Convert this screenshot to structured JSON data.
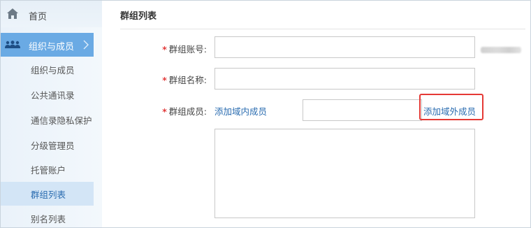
{
  "sidebar": {
    "home_label": "首页",
    "group_label": "组织与成员",
    "items": [
      {
        "label": "组织与成员"
      },
      {
        "label": "公共通讯录"
      },
      {
        "label": "通信录隐私保护"
      },
      {
        "label": "分级管理员"
      },
      {
        "label": "托管账户"
      },
      {
        "label": "群组列表"
      },
      {
        "label": "别名列表"
      }
    ],
    "active_item": "群组列表"
  },
  "main": {
    "title": "群组列表",
    "form": {
      "required_mark": "*",
      "account_label": "群组账号:",
      "account_value": "",
      "name_label": "群组名称:",
      "name_value": "",
      "members_label": "群组成员:",
      "add_internal_link": "添加域内成员",
      "add_external_link": "添加域外成员",
      "member_input_value": "",
      "members_list_value": ""
    }
  },
  "colors": {
    "accent": "#6aaae4",
    "link": "#2a6cb0",
    "required": "#e23b3b",
    "highlight": "#e53935"
  },
  "icons": {
    "home": "home-icon",
    "group": "people-group-icon",
    "chevron": "chevron-right-icon"
  }
}
